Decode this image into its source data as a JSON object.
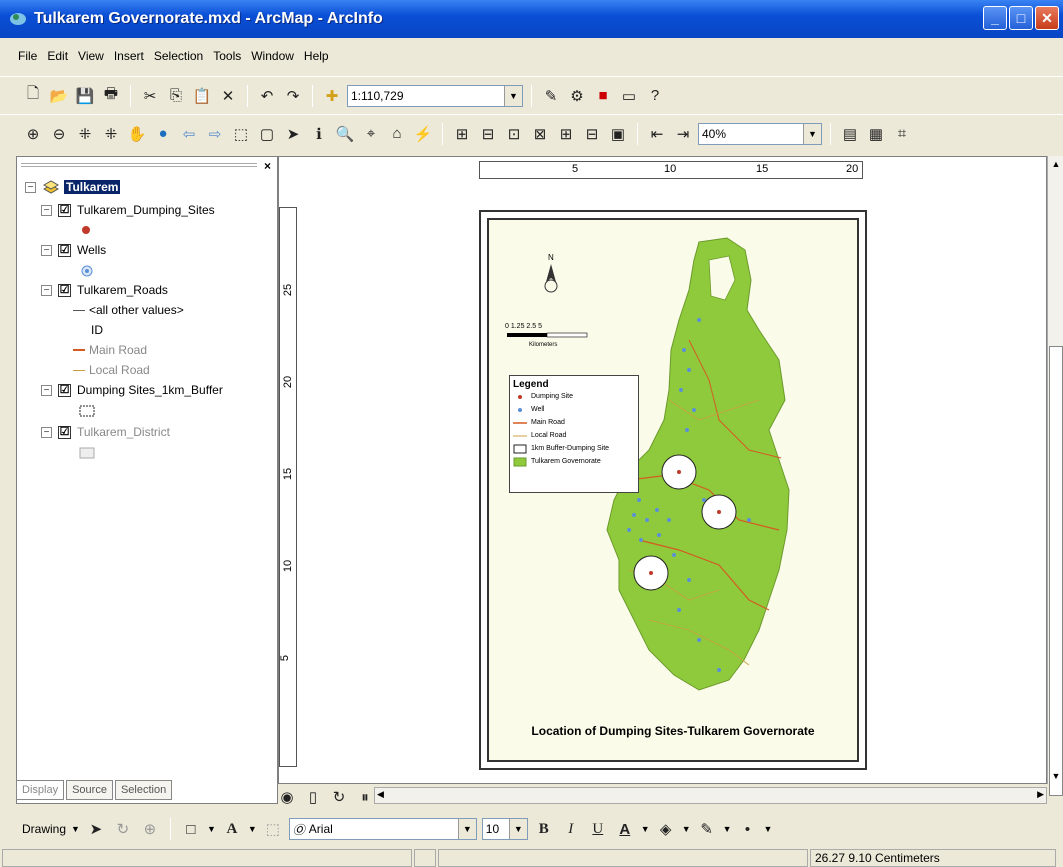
{
  "window": {
    "title": "Tulkarem Governorate.mxd - ArcMap - ArcInfo"
  },
  "menu": [
    "File",
    "Edit",
    "View",
    "Insert",
    "Selection",
    "Tools",
    "Window",
    "Help"
  ],
  "toolbar": {
    "scale_value": "1:110,729",
    "zoom_value": "40%"
  },
  "toc": {
    "close_label": "×",
    "frame_name": "Tulkarem",
    "layers": [
      {
        "name": "Tulkarem_Dumping_Sites",
        "checked": "☑"
      },
      {
        "name": "Wells",
        "checked": "☑"
      },
      {
        "name": "Tulkarem_Roads",
        "checked": "☑"
      },
      {
        "name": "Dumping Sites_1km_Buffer",
        "checked": "☑"
      },
      {
        "name": "Tulkarem_District",
        "checked": "☑"
      }
    ],
    "roads_legend": {
      "other": "<all other values>",
      "field": "ID",
      "main": "Main Road",
      "local": "Local Road"
    },
    "tabs": [
      "Display",
      "Source",
      "Selection"
    ]
  },
  "ruler": {
    "h_ticks": [
      "5",
      "10",
      "15",
      "20"
    ],
    "v_ticks": [
      "25",
      "20",
      "15",
      "10",
      "5"
    ]
  },
  "map": {
    "north_label": "N",
    "scale_text": "0  1.25 2.5        5",
    "scale_unit": "Kilometers",
    "legend_title": "Legend",
    "legend_items": [
      "Dumping Site",
      "Well",
      "Main Road",
      "Local Road",
      "1km Buffer-Dumping Site",
      "Tulkarem Governorate"
    ],
    "title": "Location of Dumping Sites-Tulkarem Governorate",
    "colors": {
      "governorate": "#8fca3c",
      "buffer": "#ffffff",
      "dumping": "#c0392b",
      "well": "#5b8fd6",
      "main_road": "#d45b22",
      "local_road": "#c9a040"
    }
  },
  "drawing": {
    "label": "Drawing",
    "font_name": "Arial",
    "font_size": "10"
  },
  "status": {
    "coordinates": "26.27  9.10 Centimeters"
  }
}
